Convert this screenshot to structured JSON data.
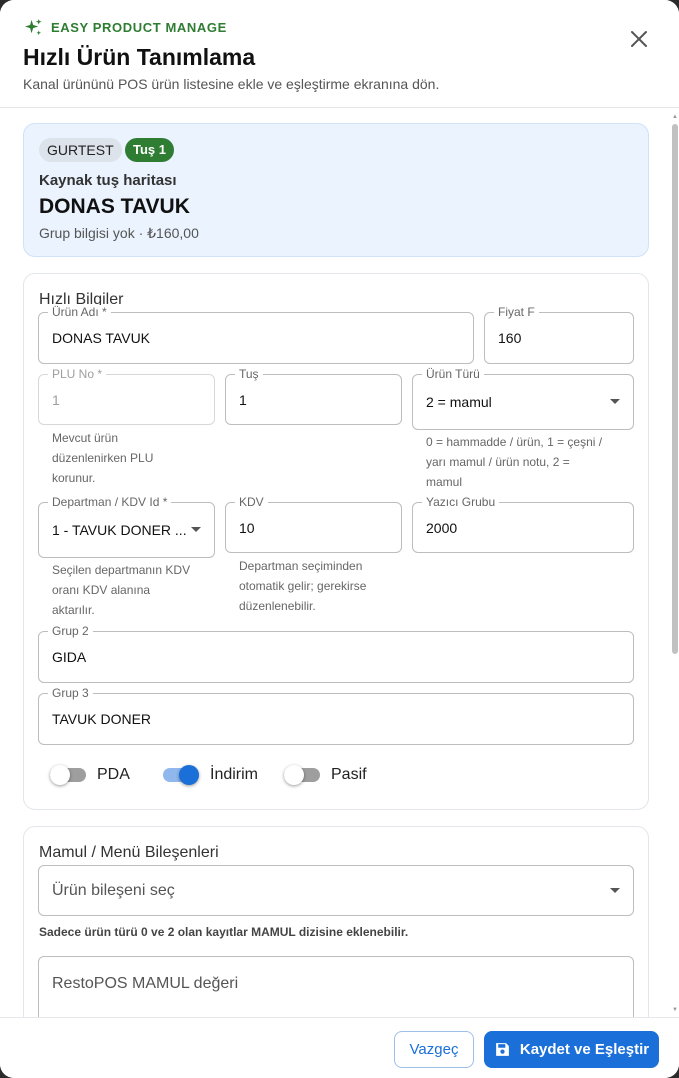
{
  "header": {
    "brand": "EASY PRODUCT MANAGE",
    "title": "Hızlı Ürün Tanımlama",
    "subtitle": "Kanal ürününü POS ürün listesine ekle ve eşleştirme ekranına dön."
  },
  "source": {
    "chip_code": "GURTEST",
    "chip_key": "Tuş 1",
    "label": "Kaynak tuş haritası",
    "name": "DONAS TAVUK",
    "meta": "Grup bilgisi yok · ₺160,00"
  },
  "quick_info": {
    "title": "Hızlı Bilgiler",
    "product_name": {
      "label": "Ürün Adı *",
      "value": "DONAS TAVUK"
    },
    "price": {
      "label": "Fiyat F",
      "value": "160"
    },
    "plu": {
      "label": "PLU No *",
      "value": "1",
      "helper": [
        "Mevcut ürün",
        "düzenlenirken PLU",
        "korunur."
      ]
    },
    "key": {
      "label": "Tuş",
      "value": "1"
    },
    "product_type": {
      "label": "Ürün Türü",
      "value": "2 = mamul",
      "helper": [
        "0 = hammadde / ürün, 1 = çeşni /",
        "yarı mamul / ürün notu, 2 =",
        "mamul"
      ]
    },
    "department": {
      "label": "Departman / KDV Id *",
      "value": "1 - TAVUK DONER ...",
      "helper": [
        "Seçilen departmanın KDV",
        "oranı KDV alanına",
        "aktarılır."
      ]
    },
    "vat": {
      "label": "KDV",
      "value": "10",
      "helper": [
        "Departman seçiminden",
        "otomatik gelir; gerekirse",
        "düzenlenebilir."
      ]
    },
    "printer_group": {
      "label": "Yazıcı Grubu",
      "value": "2000"
    },
    "group2": {
      "label": "Grup 2",
      "value": "GIDA"
    },
    "group3": {
      "label": "Grup 3",
      "value": "TAVUK DONER"
    },
    "toggles": [
      {
        "label": "PDA",
        "on": false
      },
      {
        "label": "İndirim",
        "on": true
      },
      {
        "label": "Pasif",
        "on": false
      }
    ]
  },
  "components": {
    "title": "Mamul / Menü Bileşenleri",
    "select_placeholder": "Ürün bileşeni seç",
    "note": "Sadece ürün türü 0 ve 2 olan kayıtlar MAMUL dizisine eklenebilir.",
    "mamul_placeholder": "RestoPOS MAMUL değeri"
  },
  "footer": {
    "cancel_label": "Vazgeç",
    "save_label": "Kaydet ve Eşleştir"
  },
  "colors": {
    "accent": "#1a6fd8",
    "brand_green": "#2e7d32",
    "card_bg": "#eaf3fe"
  }
}
